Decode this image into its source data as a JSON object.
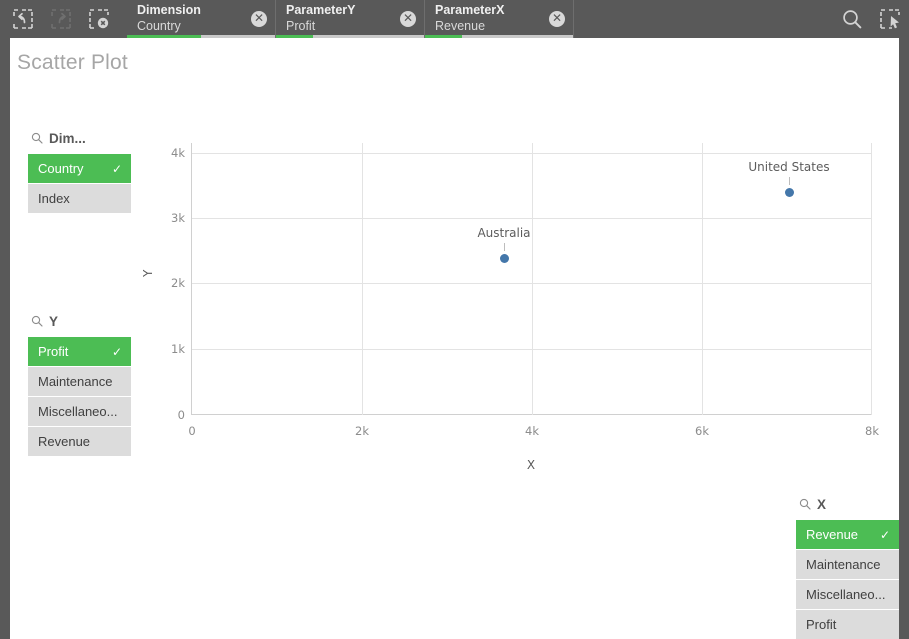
{
  "toolbar": {
    "buttons": [
      {
        "name": "step-back-selection",
        "icon": "selection-back-icon",
        "label": "Step back",
        "enabled": true
      },
      {
        "name": "step-forward-selection",
        "icon": "selection-forward-icon",
        "label": "Step forward",
        "enabled": false
      },
      {
        "name": "clear-all-selections",
        "icon": "selection-clear-icon",
        "label": "Clear all selections",
        "enabled": true
      }
    ],
    "right_buttons": [
      {
        "name": "smart-search",
        "icon": "search-icon",
        "label": "Smart search"
      },
      {
        "name": "selections-tool",
        "icon": "selections-tool-icon",
        "label": "Selections tool"
      }
    ]
  },
  "selection_chips": [
    {
      "field": "Dimension",
      "value": "Country",
      "clear_label": "✕",
      "bar_percent": 50
    },
    {
      "field": "ParameterY",
      "value": "Profit",
      "clear_label": "✕",
      "bar_percent": 25
    },
    {
      "field": "ParameterX",
      "value": "Revenue",
      "clear_label": "✕",
      "bar_percent": 25
    }
  ],
  "sheet": {
    "title": "Scatter Plot"
  },
  "listboxes": {
    "dimension": {
      "title": "Dim...",
      "search_icon": "search-icon",
      "tick": "✓",
      "items": [
        {
          "label": "Country",
          "selected": true
        },
        {
          "label": "Index",
          "selected": false
        }
      ]
    },
    "y": {
      "title": "Y",
      "search_icon": "search-icon",
      "tick": "✓",
      "items": [
        {
          "label": "Profit",
          "selected": true
        },
        {
          "label": "Maintenance",
          "selected": false
        },
        {
          "label": "Miscellaneo...",
          "selected": false
        },
        {
          "label": "Revenue",
          "selected": false
        }
      ]
    },
    "x": {
      "title": "X",
      "search_icon": "search-icon",
      "tick": "✓",
      "items": [
        {
          "label": "Revenue",
          "selected": true
        },
        {
          "label": "Maintenance",
          "selected": false
        },
        {
          "label": "Miscellaneo...",
          "selected": false
        },
        {
          "label": "Profit",
          "selected": false
        }
      ]
    }
  },
  "chart_data": {
    "type": "scatter",
    "title": "Scatter Plot",
    "xlabel": "X",
    "ylabel": "Y",
    "xlim": [
      0,
      8000
    ],
    "ylim": [
      0,
      4000
    ],
    "xticks": [
      0,
      2000,
      4000,
      6000,
      8000
    ],
    "xtick_labels": [
      "0",
      "2k",
      "4k",
      "6k",
      "8k"
    ],
    "yticks": [
      0,
      1000,
      2000,
      3000,
      4000
    ],
    "ytick_labels": [
      "0",
      "1k",
      "2k",
      "3k",
      "4k"
    ],
    "grid": true,
    "legend": null,
    "point_color": "#4477aa",
    "points": [
      {
        "label": "United States",
        "x": 7020,
        "y": 3400
      },
      {
        "label": "Australia",
        "x": 3670,
        "y": 2400
      }
    ]
  },
  "colors": {
    "accent_green": "#4cbd54",
    "toolbar_bg": "#595959",
    "listbox_item_bg": "#dcdcdc",
    "point_blue": "#4477aa",
    "title_gray": "#a6a6a6"
  }
}
